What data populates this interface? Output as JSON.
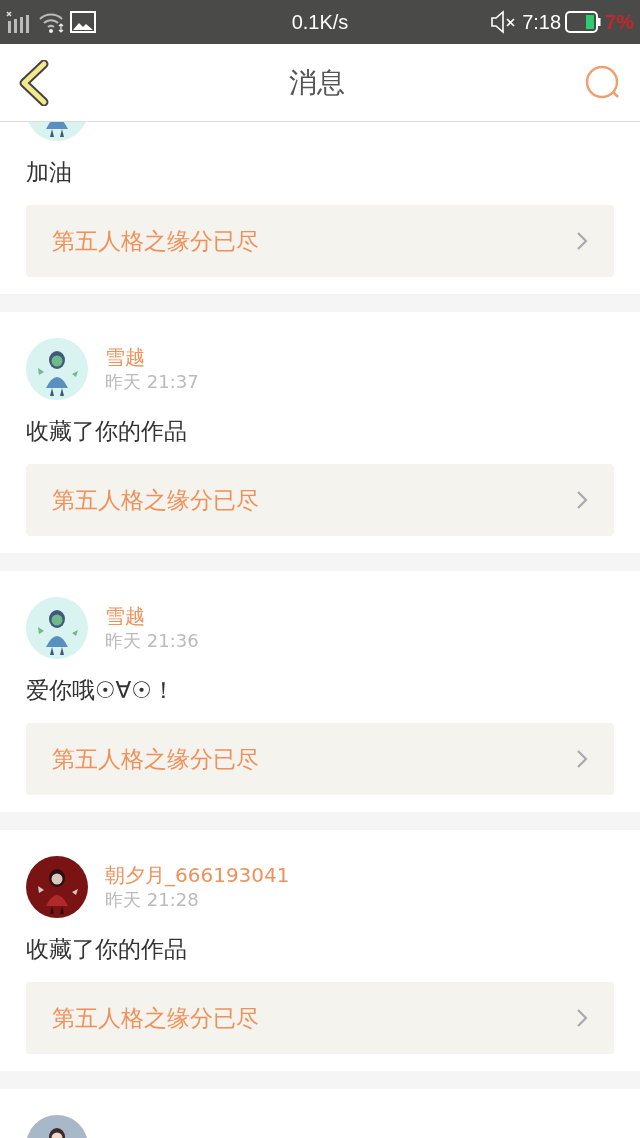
{
  "status_bar": {
    "speed": "0.1K/s",
    "time": "7:18",
    "battery": "7%"
  },
  "header": {
    "title": "消息"
  },
  "messages": [
    {
      "avatar": {
        "kind": "picture"
      },
      "text": "加油",
      "work": "第五人格之缘分已尽"
    },
    {
      "name": "雪越",
      "time": "昨天 21:37",
      "avatar": {
        "kind": "picture"
      },
      "text": "收藏了你的作品",
      "work": "第五人格之缘分已尽"
    },
    {
      "name": "雪越",
      "time": "昨天 21:36",
      "avatar": {
        "kind": "picture"
      },
      "text": "爱你哦☉∀☉！",
      "work": "第五人格之缘分已尽"
    },
    {
      "name": "朝夕月_666193041",
      "time": "昨天 21:28",
      "avatar": {
        "kind": "picture"
      },
      "text": "收藏了你的作品",
      "work": "第五人格之缘分已尽"
    },
    {
      "avatar": {
        "kind": "picture"
      }
    }
  ]
}
